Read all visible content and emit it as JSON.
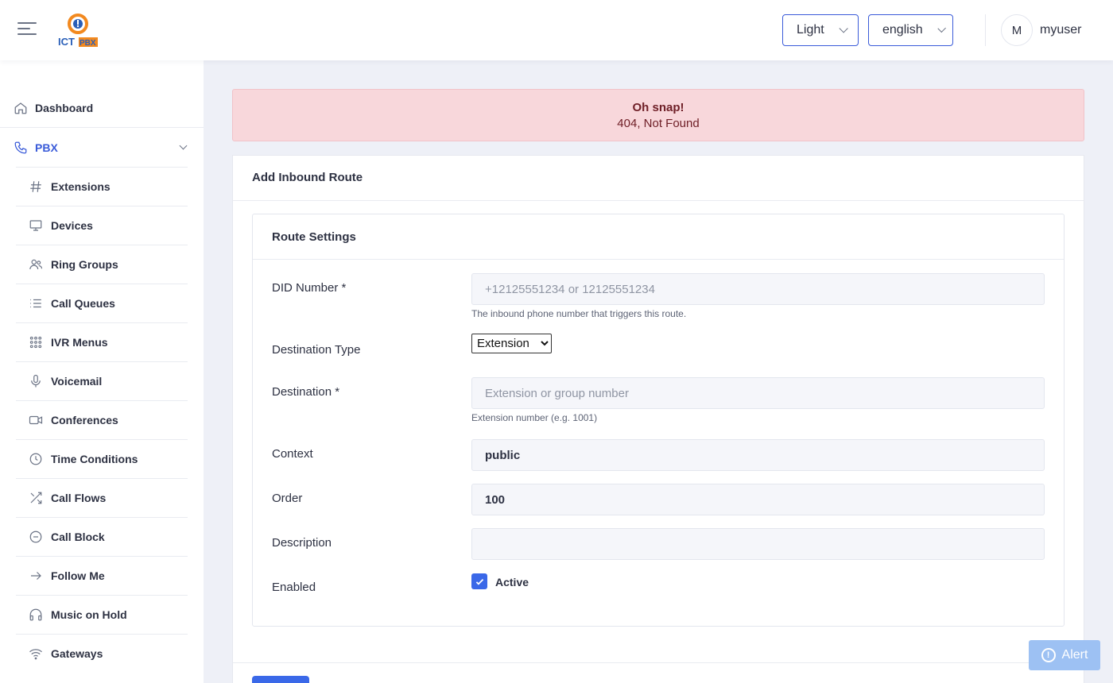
{
  "header": {
    "logo_text": "ICTPBX",
    "theme": "Light",
    "language": "english",
    "avatar_initial": "M",
    "username": "myuser"
  },
  "sidebar": {
    "dashboard": {
      "label": "Dashboard",
      "icon": "home-icon"
    },
    "pbx": {
      "label": "PBX",
      "icon": "phone-icon"
    },
    "items": [
      {
        "label": "Extensions",
        "icon": "hash-icon"
      },
      {
        "label": "Devices",
        "icon": "monitor-icon"
      },
      {
        "label": "Ring Groups",
        "icon": "users-icon"
      },
      {
        "label": "Call Queues",
        "icon": "list-icon"
      },
      {
        "label": "IVR Menus",
        "icon": "grid-dots-icon"
      },
      {
        "label": "Voicemail",
        "icon": "microphone-icon"
      },
      {
        "label": "Conferences",
        "icon": "video-icon"
      },
      {
        "label": "Time Conditions",
        "icon": "clock-icon"
      },
      {
        "label": "Call Flows",
        "icon": "shuffle-icon"
      },
      {
        "label": "Call Block",
        "icon": "minus-circle-icon"
      },
      {
        "label": "Follow Me",
        "icon": "arrow-right-icon"
      },
      {
        "label": "Music on Hold",
        "icon": "headphones-icon"
      },
      {
        "label": "Gateways",
        "icon": "wifi-icon"
      }
    ]
  },
  "alert": {
    "title": "Oh snap!",
    "message": "404, Not Found"
  },
  "card": {
    "title": "Add Inbound Route",
    "section_title": "Route Settings",
    "fields": {
      "did_number": {
        "label": "DID Number *",
        "placeholder": "+12125551234 or 12125551234",
        "help": "The inbound phone number that triggers this route."
      },
      "destination_type": {
        "label": "Destination Type",
        "selected": "Extension"
      },
      "destination": {
        "label": "Destination *",
        "placeholder": "Extension or group number",
        "help": "Extension number (e.g. 1001)"
      },
      "context": {
        "label": "Context",
        "value": "public"
      },
      "order": {
        "label": "Order",
        "value": "100"
      },
      "description": {
        "label": "Description",
        "value": ""
      },
      "enabled": {
        "label": "Enabled",
        "checkbox_label": "Active",
        "checked": true
      }
    }
  },
  "floating_alert": {
    "label": "Alert"
  },
  "colors": {
    "accent": "#3a68e8",
    "alert_bg": "#f8d7db",
    "alert_text": "#6e1e26",
    "page_bg": "#eef0f7"
  }
}
